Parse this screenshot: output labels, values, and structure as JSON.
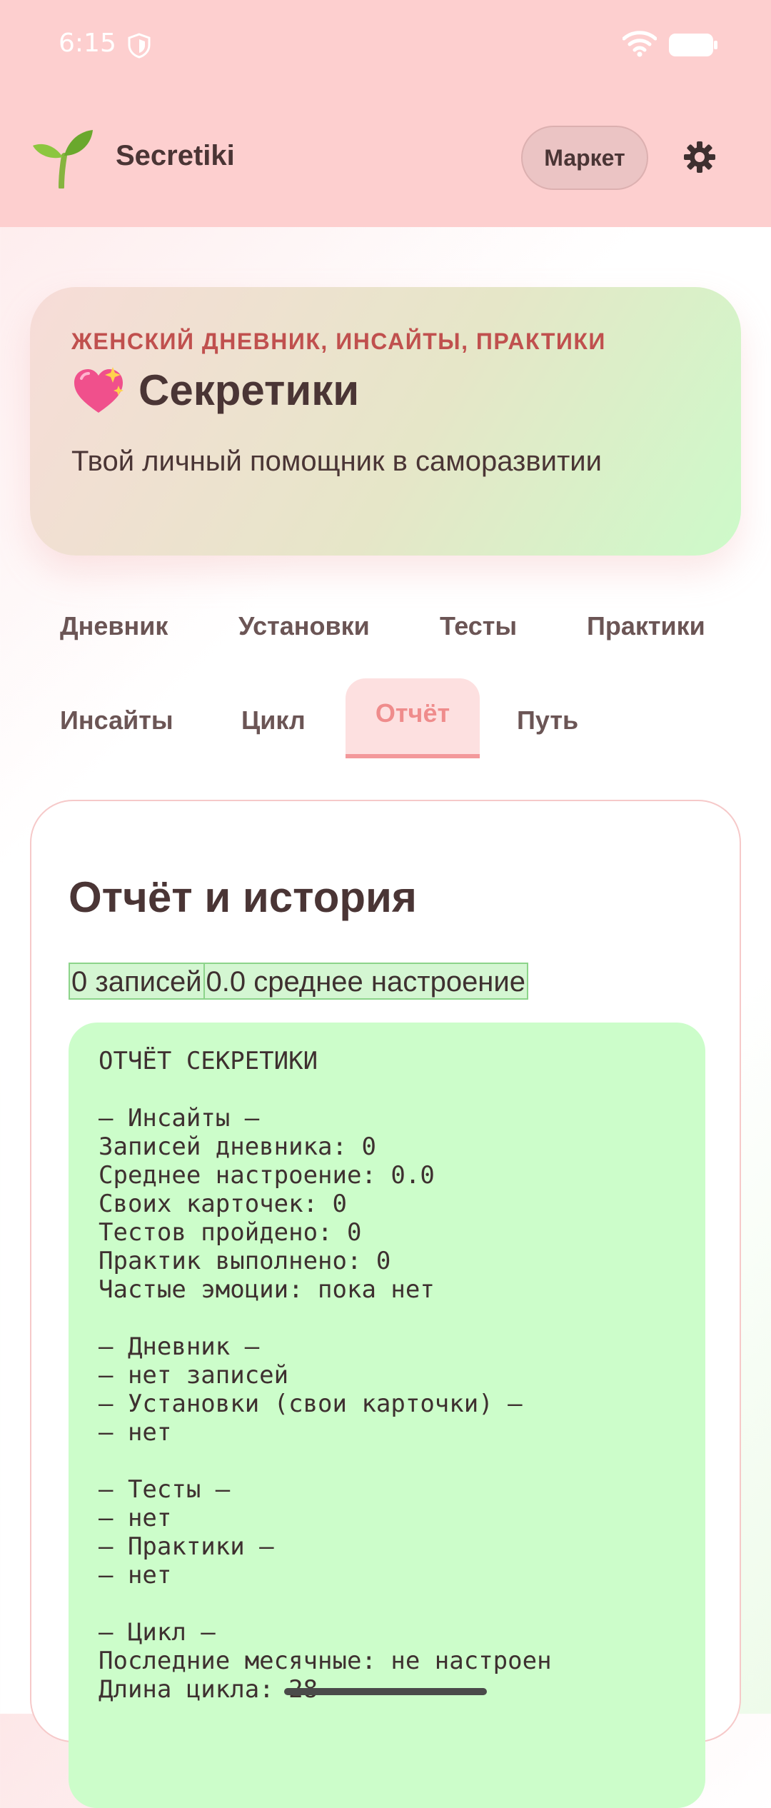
{
  "status": {
    "time": "6:15"
  },
  "app": {
    "name": "Secretiki",
    "market_label": "Маркет"
  },
  "hero": {
    "kicker": "ЖЕНСКИЙ ДНЕВНИК, ИНСАЙТЫ, ПРАКТИКИ",
    "title": "Секретики",
    "subtitle": "Твой личный помощник в саморазвитии"
  },
  "tabs": [
    {
      "label": "Дневник"
    },
    {
      "label": "Установки"
    },
    {
      "label": "Тесты"
    },
    {
      "label": "Практики"
    },
    {
      "label": "Инсайты"
    },
    {
      "label": "Цикл"
    },
    {
      "label": "Отчёт",
      "active": true
    },
    {
      "label": "Путь"
    }
  ],
  "report": {
    "title": "Отчёт и история",
    "stat_entries": "0 записей",
    "stat_mood": "0.0 среднее настроение",
    "lines": [
      "ОТЧЁТ СЕКРЕТИКИ",
      "",
      "— Инсайты —",
      "Записей дневника: 0",
      "Среднее настроение: 0.0",
      "Своих карточек: 0",
      "Тестов пройдено: 0",
      "Практик выполнено: 0",
      "Частые эмоции: пока нет",
      "",
      "— Дневник —",
      "— нет записей",
      "— Установки (свои карточки) —",
      "— нет",
      "",
      "— Тесты —",
      "— нет",
      "— Практики —",
      "— нет",
      "",
      "— Цикл —",
      "Последние месячные: не настроен",
      "Длина цикла: 28"
    ]
  },
  "colors": {
    "header_bg": "#fdcfcf",
    "accent": "#ef8c8c",
    "kicker": "#c0504e",
    "report_bg": "#ccfdca",
    "text": "#4a3535"
  },
  "icons": [
    "shield-icon",
    "wifi-icon",
    "battery-icon",
    "sprout-logo-icon",
    "gear-icon",
    "sparkling-heart-icon"
  ]
}
